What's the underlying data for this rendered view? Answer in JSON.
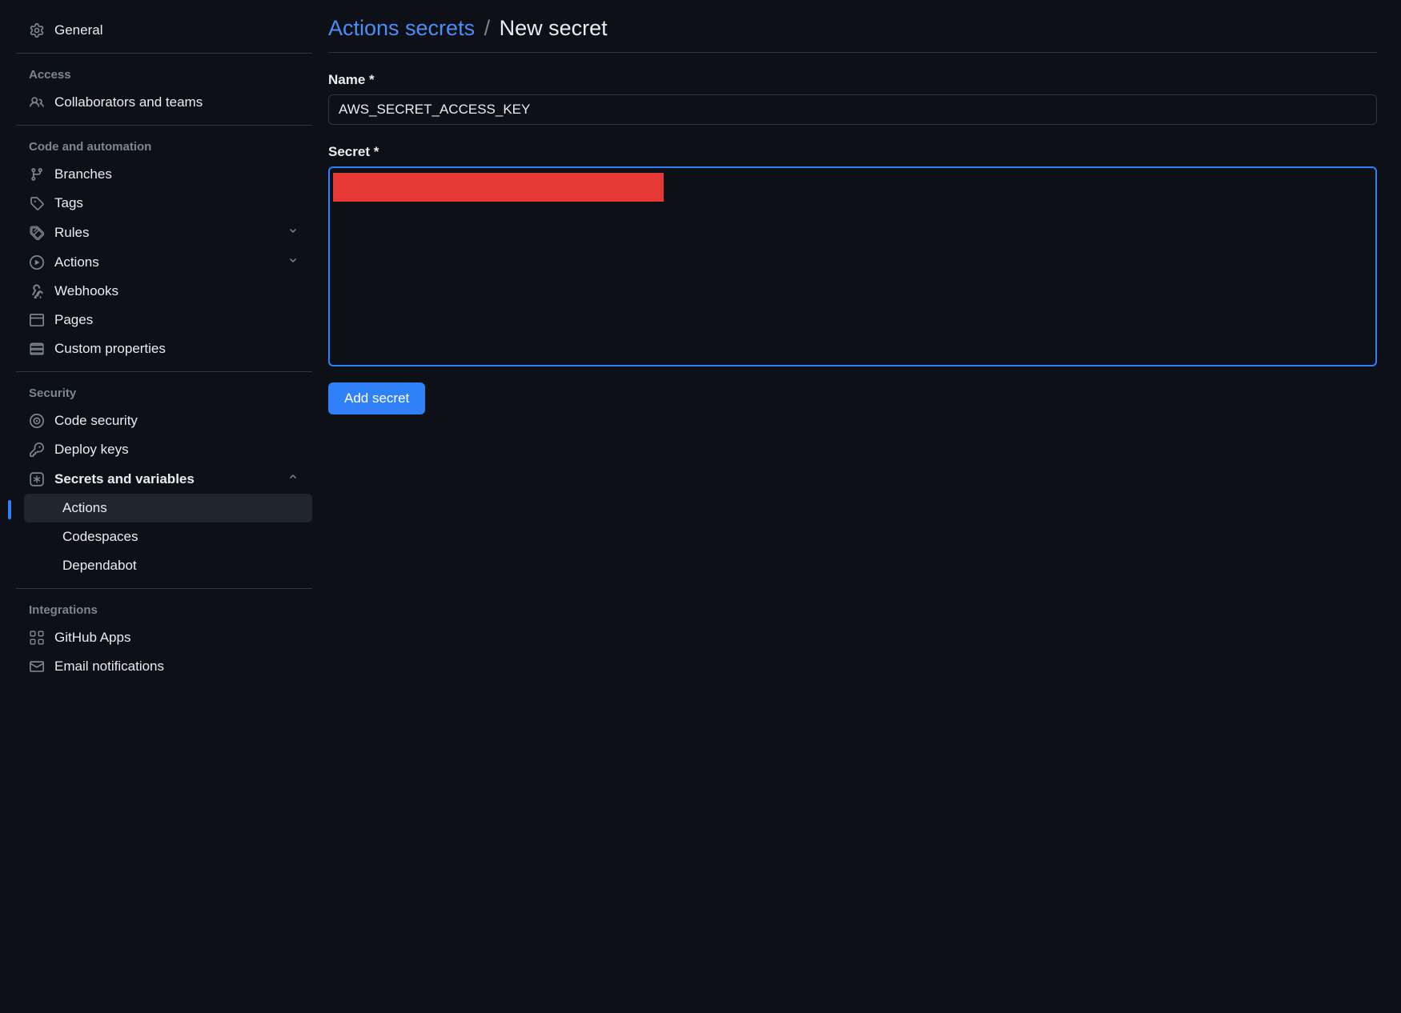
{
  "sidebar": {
    "general": "General",
    "sections": {
      "access": {
        "title": "Access",
        "items": [
          "Collaborators and teams"
        ]
      },
      "code": {
        "title": "Code and automation",
        "items": [
          "Branches",
          "Tags",
          "Rules",
          "Actions",
          "Webhooks",
          "Pages",
          "Custom properties"
        ]
      },
      "security": {
        "title": "Security",
        "items": [
          "Code security",
          "Deploy keys",
          "Secrets and variables"
        ],
        "secrets_sub": [
          "Actions",
          "Codespaces",
          "Dependabot"
        ]
      },
      "integrations": {
        "title": "Integrations",
        "items": [
          "GitHub Apps",
          "Email notifications"
        ]
      }
    }
  },
  "main": {
    "breadcrumb_link": "Actions secrets",
    "breadcrumb_current": "New secret",
    "name_label": "Name *",
    "name_value": "AWS_SECRET_ACCESS_KEY",
    "secret_label": "Secret *",
    "submit": "Add secret"
  }
}
